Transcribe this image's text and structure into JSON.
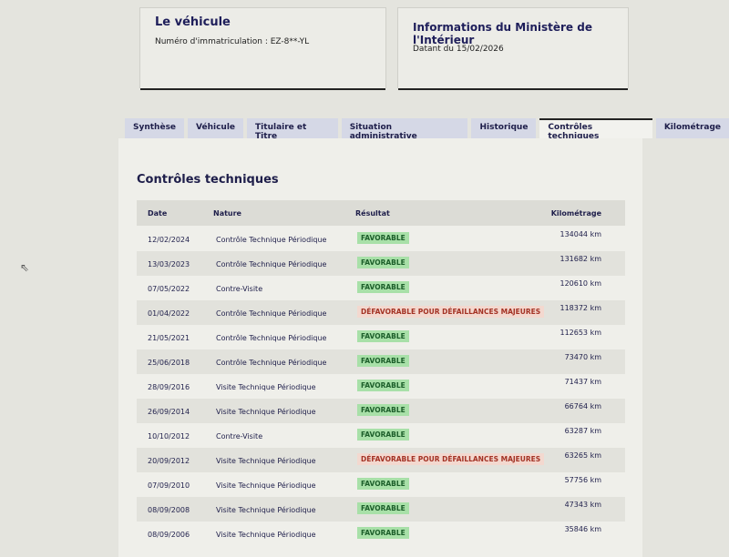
{
  "vehicle_card": {
    "title": "Le véhicule",
    "registration": "Numéro d'immatriculation : EZ-8**-YL"
  },
  "ministry_card": {
    "title": "Informations du Ministère de l'Intérieur",
    "date": "Datant du 15/02/2026"
  },
  "tabs": [
    {
      "label": "Synthèse"
    },
    {
      "label": "Véhicule"
    },
    {
      "label": "Titulaire et Titre"
    },
    {
      "label": "Situation administrative"
    },
    {
      "label": "Historique"
    },
    {
      "label": "Contrôles techniques",
      "active": true
    },
    {
      "label": "Kilométrage"
    }
  ],
  "section": {
    "title": "Contrôles techniques",
    "columns": {
      "date": "Date",
      "nature": "Nature",
      "result": "Résultat",
      "mileage": "Kilométrage"
    },
    "rows": [
      {
        "date": "12/02/2024",
        "nature": "Contrôle Technique Périodique",
        "result": "FAVORABLE",
        "mileage": "134044 km"
      },
      {
        "date": "13/03/2023",
        "nature": "Contrôle Technique Périodique",
        "result": "FAVORABLE",
        "mileage": "131682 km"
      },
      {
        "date": "07/05/2022",
        "nature": "Contre-Visite",
        "result": "FAVORABLE",
        "mileage": "120610 km"
      },
      {
        "date": "01/04/2022",
        "nature": "Contrôle Technique Périodique",
        "result": "DÉFAVORABLE POUR DÉFAILLANCES MAJEURES",
        "mileage": "118372 km"
      },
      {
        "date": "21/05/2021",
        "nature": "Contrôle Technique Périodique",
        "result": "FAVORABLE",
        "mileage": "112653 km"
      },
      {
        "date": "25/06/2018",
        "nature": "Contrôle Technique Périodique",
        "result": "FAVORABLE",
        "mileage": "73470 km"
      },
      {
        "date": "28/09/2016",
        "nature": "Visite Technique Périodique",
        "result": "FAVORABLE",
        "mileage": "71437 km"
      },
      {
        "date": "26/09/2014",
        "nature": "Visite Technique Périodique",
        "result": "FAVORABLE",
        "mileage": "66764 km"
      },
      {
        "date": "10/10/2012",
        "nature": "Contre-Visite",
        "result": "FAVORABLE",
        "mileage": "63287 km"
      },
      {
        "date": "20/09/2012",
        "nature": "Visite Technique Périodique",
        "result": "DÉFAVORABLE POUR DÉFAILLANCES MAJEURES",
        "mileage": "63265 km"
      },
      {
        "date": "07/09/2010",
        "nature": "Visite Technique Périodique",
        "result": "FAVORABLE",
        "mileage": "57756 km"
      },
      {
        "date": "08/09/2008",
        "nature": "Visite Technique Périodique",
        "result": "FAVORABLE",
        "mileage": "47343 km"
      },
      {
        "date": "08/09/2006",
        "nature": "Visite Technique Périodique",
        "result": "FAVORABLE",
        "mileage": "35846 km"
      }
    ]
  },
  "colors": {
    "favorable_bg": "#a8e0a8",
    "favorable_text": "#1c5e2a",
    "defavorable_bg": "#f3d8cf",
    "defavorable_text": "#a33224",
    "title": "#1e1e4a"
  }
}
